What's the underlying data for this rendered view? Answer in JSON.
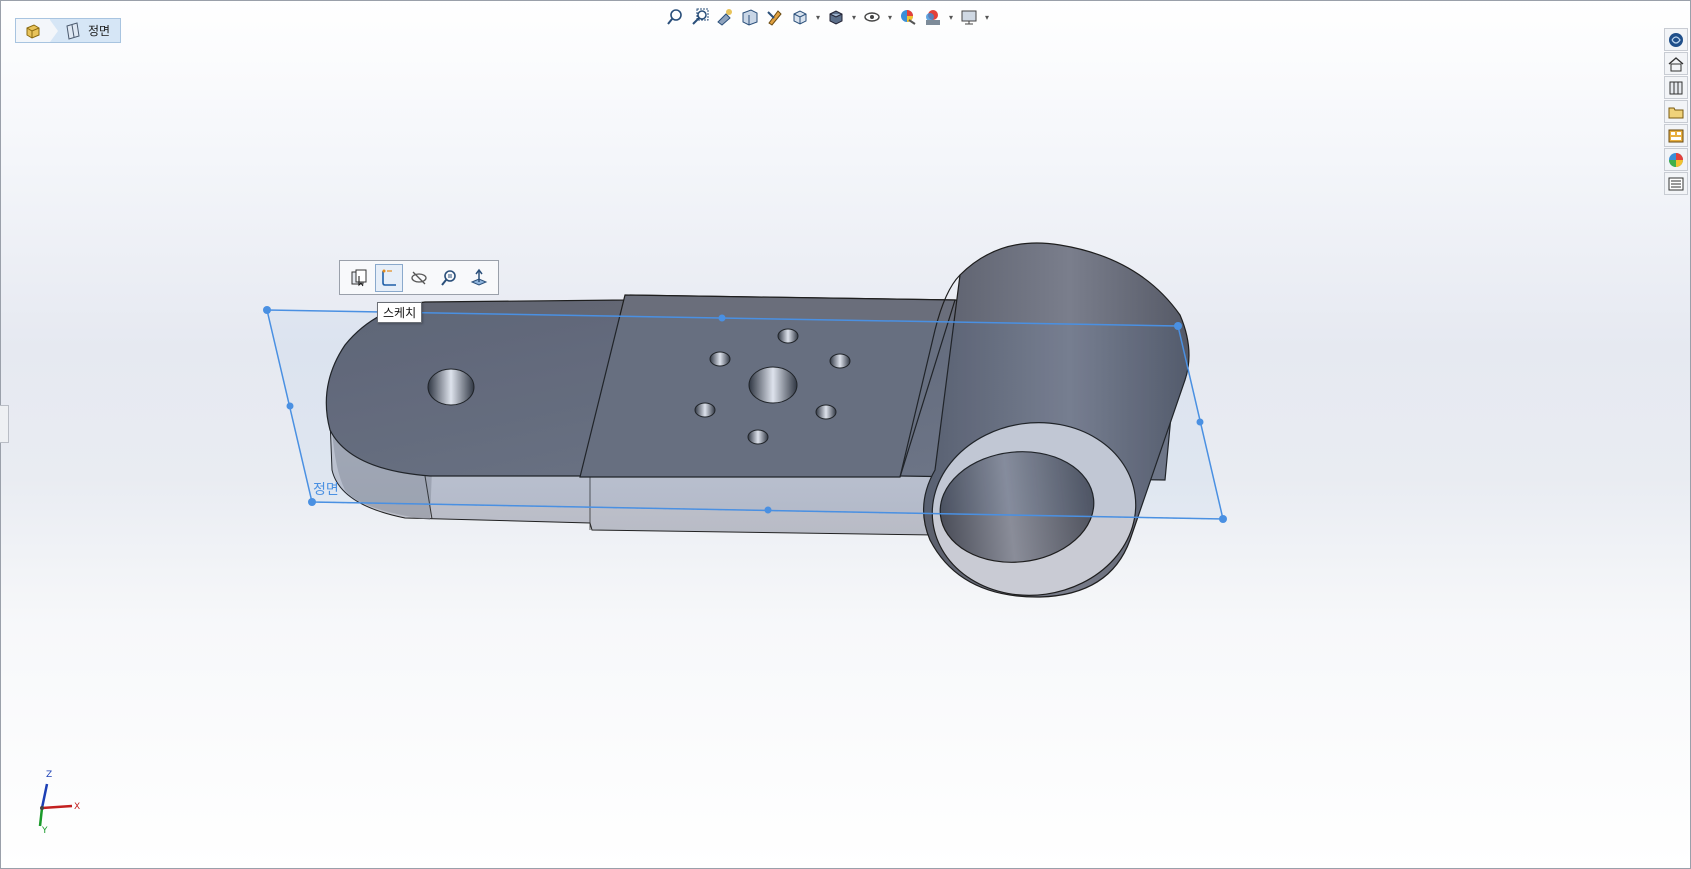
{
  "breadcrumb": {
    "part_icon": "part-icon",
    "plane_icon": "plane-icon",
    "label": "정면"
  },
  "heads_up_toolbar": {
    "icons": [
      "zoom-to-fit-icon",
      "zoom-to-area-icon",
      "previous-view-icon",
      "section-view-icon",
      "dynamic-annotation-icon",
      "view-orientation-icon",
      "display-style-icon",
      "hide-show-icon",
      "edit-appearance-icon",
      "apply-scene-icon",
      "view-settings-icon"
    ]
  },
  "task_pane": {
    "icons": [
      "solidworks-resources-icon",
      "home-icon",
      "design-library-icon",
      "file-explorer-icon",
      "view-palette-icon",
      "appearances-icon",
      "custom-properties-icon"
    ]
  },
  "context_toolbar": {
    "buttons": [
      "view-selector-icon",
      "sketch-icon",
      "hide-icon",
      "zoom-to-selection-icon",
      "normal-to-icon"
    ],
    "tooltip": "스케치"
  },
  "plane": {
    "label": "정면",
    "color": "#4a90e2"
  },
  "model": {
    "color": "#6b6f7c",
    "side_color": "#c8cad3"
  },
  "triad": {
    "x": "X",
    "y": "Y",
    "z": "Z"
  }
}
